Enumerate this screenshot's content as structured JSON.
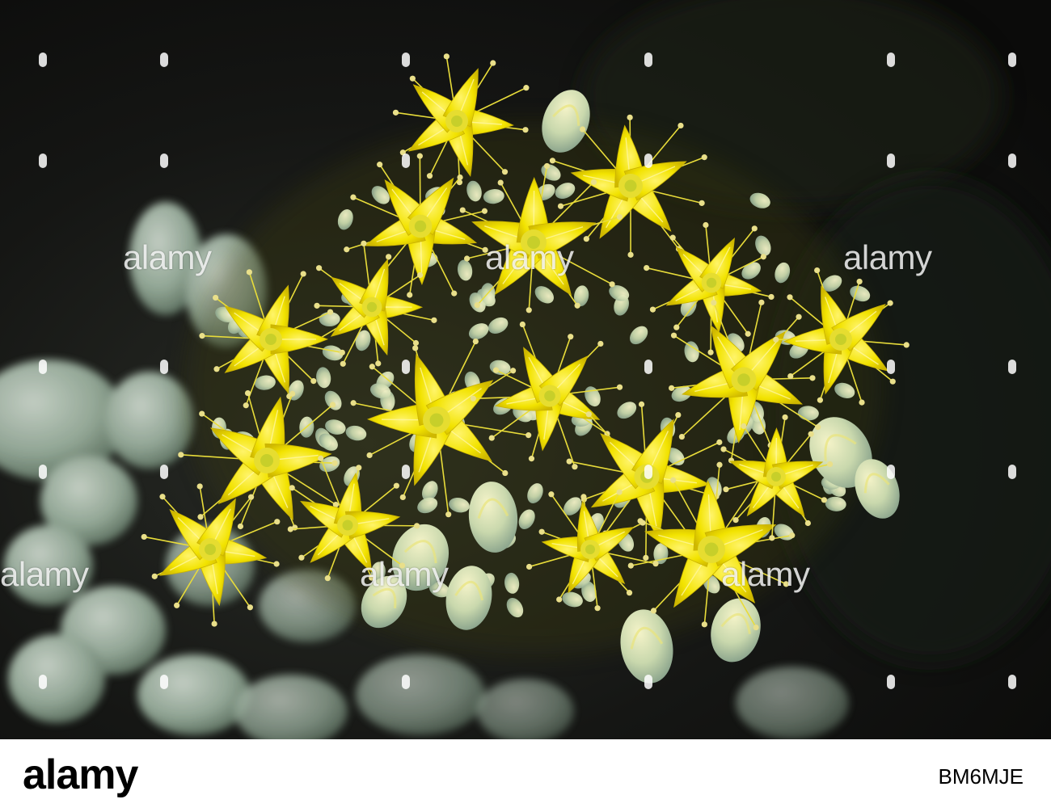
{
  "photo": {
    "subject": "yellow star-shaped succulent flower cluster",
    "background_color": "#111110",
    "petal_color": "#f2e300",
    "bud_color": "#b9cfb0",
    "leaf_color": "#9fb5a3"
  },
  "watermark": {
    "text": "alamy"
  },
  "footer": {
    "logo": "alamy",
    "image_id": "BM6MJE"
  }
}
